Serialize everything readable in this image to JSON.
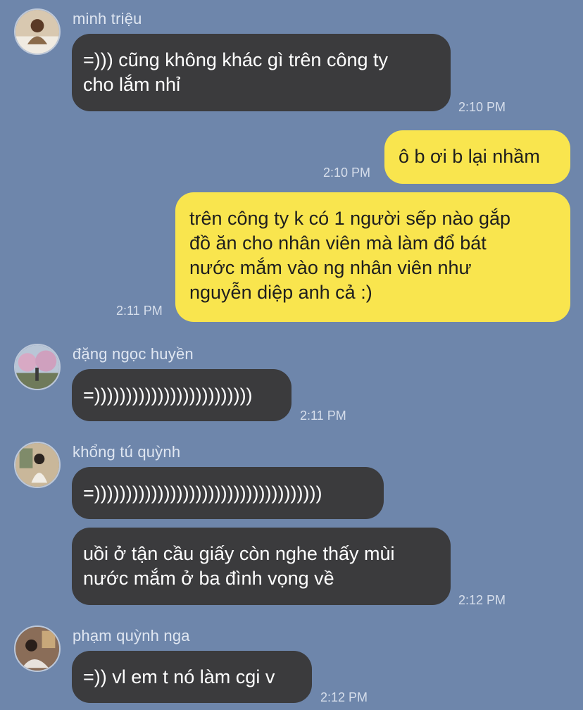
{
  "messages": [
    {
      "sender": "minh triệu",
      "text": "=))) cũng không khác gì trên công ty\ncho lắm nhỉ",
      "time": "2:10 PM",
      "direction": "incoming",
      "avatar": "photo-minh-trieu"
    },
    {
      "text": "ô b ơi b lại nhầm",
      "time": "2:10 PM",
      "direction": "outgoing"
    },
    {
      "text": "trên công ty k có 1 người sếp nào gắp\nđồ ăn cho nhân viên mà làm đổ bát\nnước mắm vào ng nhân viên như\nnguyễn diệp anh cả :)",
      "time": "2:11 PM",
      "direction": "outgoing"
    },
    {
      "sender": "đặng ngọc huyền",
      "text": "=)))))))))))))))))))))))))",
      "time": "2:11 PM",
      "direction": "incoming",
      "avatar": "photo-dang-ngoc-huyen"
    },
    {
      "sender": "khổng tú quỳnh",
      "text": "=))))))))))))))))))))))))))))))))))))",
      "direction": "incoming",
      "avatar": "photo-khong-tu-quynh"
    },
    {
      "text": "uồi ở tận cầu giấy còn nghe thấy mùi\nnước mắm ở ba đình vọng về",
      "time": "2:12 PM",
      "direction": "incoming"
    },
    {
      "sender": "phạm quỳnh nga",
      "text": "=)) vl em t nó làm cgi v",
      "time": "2:12 PM",
      "direction": "incoming",
      "avatar": "photo-pham-quynh-nga"
    }
  ],
  "colors": {
    "background": "#6e86ab",
    "incoming_bubble": "#3b3b3d",
    "outgoing_bubble": "#f9e54e",
    "incoming_text": "#ffffff",
    "outgoing_text": "#1e1e1e",
    "name_text": "#dfe6f1",
    "time_text": "#d6deeb"
  }
}
